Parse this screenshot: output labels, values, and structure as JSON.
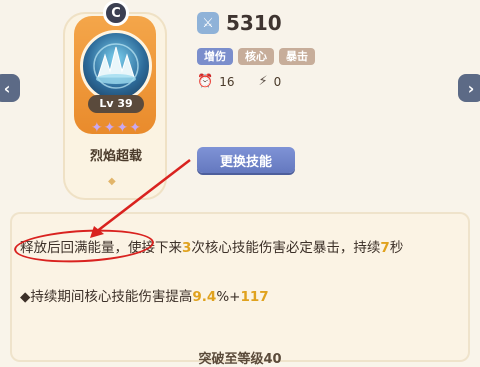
{
  "card": {
    "level": "Lv 39",
    "stars": [
      "✦",
      "✦",
      "✦",
      "✦"
    ],
    "skill_name": "烈焰超载",
    "badge_icon": "C"
  },
  "stats": {
    "damage_value": "5310",
    "tags": [
      "增伤",
      "核心",
      "暴击"
    ],
    "cooldown": "16",
    "energy": "0"
  },
  "change_button": "更换技能",
  "description": {
    "part1": "释放后回满能量",
    "part2": "，使接下来",
    "num1": "3",
    "part3": "次核心技能伤害必定暴击，持续",
    "num2": "7",
    "part4": "秒",
    "bullet": "◆持续期间核心技能伤害提高",
    "bullet_num1": "9.4",
    "bullet_mid": "%+",
    "bullet_num2": "117"
  },
  "bottom_text": "突破至等级40",
  "colors": {
    "highlight": "#e0a21e",
    "annotation": "#d9221f",
    "button": "#6f83c9"
  }
}
